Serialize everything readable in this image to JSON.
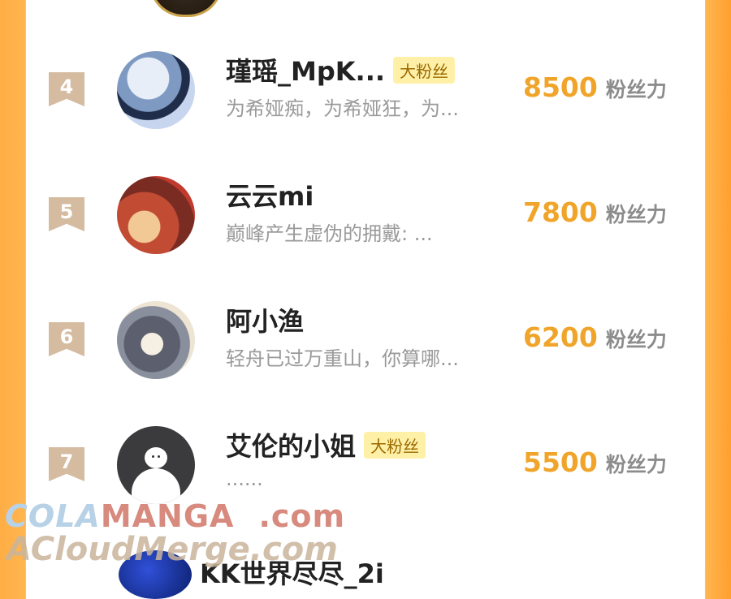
{
  "rows": [
    {
      "rank": "4",
      "name": "瑾瑶_MpK...",
      "badge": "大粉丝",
      "desc": "为希娅痴，为希娅狂，为...",
      "score": "8500",
      "unit": "粉丝力"
    },
    {
      "rank": "5",
      "name": "云云mi",
      "badge": "",
      "desc": "巅峰产生虚伪的拥戴: ...",
      "score": "7800",
      "unit": "粉丝力"
    },
    {
      "rank": "6",
      "name": "阿小渔",
      "badge": "",
      "desc": "轻舟已过万重山，你算哪...",
      "score": "6200",
      "unit": "粉丝力"
    },
    {
      "rank": "7",
      "name": "艾伦的小姐",
      "badge": "大粉丝",
      "desc": "......",
      "score": "5500",
      "unit": "粉丝力"
    }
  ],
  "partial_row": {
    "name": "KK世界尽尽_2i"
  },
  "watermark": {
    "part1": "COLA",
    "part2": "MANGA",
    "part3": ".com",
    "line2": "ACloudMerge.com"
  },
  "colors": {
    "score": "#f0a52a",
    "badge_bg": "#fff0a8",
    "rank_bg": "#d5bba0",
    "side_orange": "#ff9f2e"
  }
}
